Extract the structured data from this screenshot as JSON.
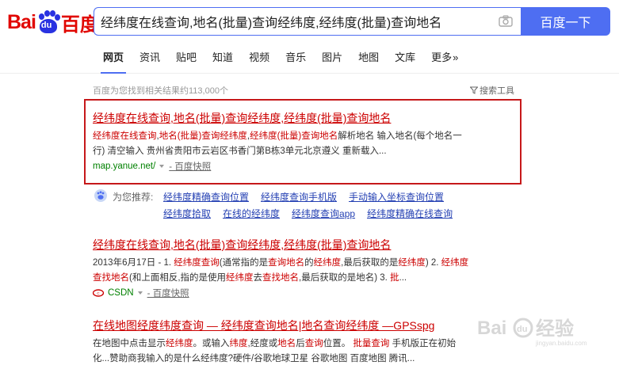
{
  "logo": {
    "bai": "Bai",
    "du": "du",
    "cn": "百度"
  },
  "search": {
    "query": "经纬度在线查询,地名(批量)查询经纬度,经纬度(批量)查询地名",
    "button": "百度一下"
  },
  "tabs": [
    "网页",
    "资讯",
    "贴吧",
    "知道",
    "视频",
    "音乐",
    "图片",
    "地图",
    "文库",
    "更多"
  ],
  "result_count": "百度为您找到相关结果约113,000个",
  "tools_label": "搜索工具",
  "results": [
    {
      "title": "经纬度在线查询,地名(批量)查询经纬度,经纬度(批量)查询地名",
      "abs_line1": [
        {
          "t": "经纬度在线查询",
          "em": true
        },
        {
          "t": ",",
          "em": false
        },
        {
          "t": "地名(批量)查询经纬度",
          "em": true
        },
        {
          "t": ",",
          "em": false
        },
        {
          "t": "经纬度(批量)查询地名",
          "em": true
        },
        {
          "t": "解析地名  输入地名(每个地名一",
          "em": false
        }
      ],
      "abs_line2": "行) 清空输入  贵州省贵阳市云岩区书香门第B栋3单元北京遵义  重新载入...",
      "url": "map.yanue.net/",
      "snapshot": "- 百度快照"
    },
    {
      "title": "经纬度在线查询,地名(批量)查询经纬度,经纬度(批量)查询地名",
      "abs_line1": [
        {
          "t": "2013年6月17日 - 1. ",
          "em": false
        },
        {
          "t": "经纬度查询",
          "em": true
        },
        {
          "t": "(通常指的是",
          "em": false
        },
        {
          "t": "查询地名",
          "em": true
        },
        {
          "t": "的",
          "em": false
        },
        {
          "t": "经纬度",
          "em": true
        },
        {
          "t": ",最后获取的是",
          "em": false
        },
        {
          "t": "经纬度",
          "em": true
        },
        {
          "t": ") 2. ",
          "em": false
        },
        {
          "t": "经纬度",
          "em": true
        }
      ],
      "abs_line2_parts": [
        {
          "t": "查找地名",
          "em": true
        },
        {
          "t": "(和上面相反,指的是使用",
          "em": false
        },
        {
          "t": "经纬度",
          "em": true
        },
        {
          "t": "去",
          "em": false
        },
        {
          "t": "查找地名",
          "em": true
        },
        {
          "t": ",最后获取的是地名) 3. ",
          "em": false
        },
        {
          "t": "批",
          "em": true
        },
        {
          "t": "...",
          "em": false
        }
      ],
      "url": "CSDN",
      "snapshot": "- 百度快照"
    },
    {
      "title": "在线地图经度纬度查询 — 经纬度查询地名|地名查询经纬度 —GPSspg",
      "abs_line1": [
        {
          "t": "在地图中点击显示",
          "em": false
        },
        {
          "t": "经纬度",
          "em": true
        },
        {
          "t": "。或输入",
          "em": false
        },
        {
          "t": "纬度",
          "em": true
        },
        {
          "t": ",经度或",
          "em": false
        },
        {
          "t": "地名",
          "em": true
        },
        {
          "t": "后",
          "em": false
        },
        {
          "t": "查询",
          "em": true
        },
        {
          "t": "位置。  ",
          "em": false
        },
        {
          "t": "批量查询",
          "em": true
        },
        {
          "t": "  手机版正在初始",
          "em": false
        }
      ],
      "abs_line2": "化...赞助商我输入的是什么经纬度?硬件/谷歌地球卫星 谷歌地图 百度地图 腾讯..."
    }
  ],
  "recommend": {
    "label": "为您推荐:",
    "row1": [
      "经纬度精确查询位置",
      "经纬度查询手机版",
      "手动输入坐标查询位置"
    ],
    "row2": [
      "经纬度拾取",
      "在线的经纬度",
      "经纬度查询app",
      "经纬度精确在线查询"
    ]
  },
  "watermark": {
    "text": "Bai",
    "du": "du",
    "cn": "经验",
    "url": "jingyan.baidu.com"
  },
  "colors": {
    "brand_blue": "#4e6ef2",
    "title_red": "#c00",
    "url_green": "#008000",
    "link_blue": "#2440b3",
    "box_red": "#c6181a"
  }
}
